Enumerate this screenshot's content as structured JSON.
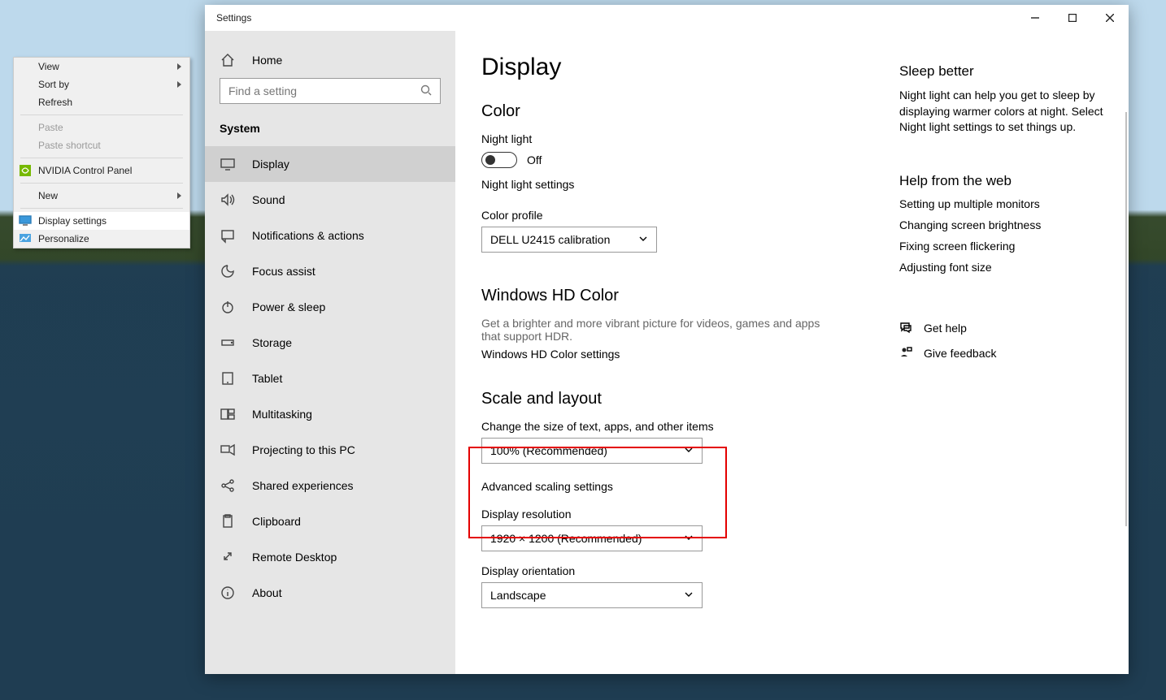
{
  "context_menu": {
    "items": [
      {
        "label": "View",
        "has_submenu": true
      },
      {
        "label": "Sort by",
        "has_submenu": true
      },
      {
        "label": "Refresh"
      }
    ],
    "items2": [
      {
        "label": "Paste",
        "disabled": true
      },
      {
        "label": "Paste shortcut",
        "disabled": true
      }
    ],
    "nvidia": "NVIDIA Control Panel",
    "new": "New",
    "display_settings": "Display settings",
    "personalize": "Personalize"
  },
  "window": {
    "title": "Settings"
  },
  "sidebar": {
    "home": "Home",
    "search_placeholder": "Find a setting",
    "group_header": "System",
    "items": [
      "Display",
      "Sound",
      "Notifications & actions",
      "Focus assist",
      "Power & sleep",
      "Storage",
      "Tablet",
      "Multitasking",
      "Projecting to this PC",
      "Shared experiences",
      "Clipboard",
      "Remote Desktop",
      "About"
    ]
  },
  "main": {
    "page_title": "Display",
    "color": {
      "heading": "Color",
      "night_light_label": "Night light",
      "night_light_state": "Off",
      "night_light_settings": "Night light settings",
      "color_profile_label": "Color profile",
      "color_profile_value": "DELL U2415 calibration"
    },
    "hdcolor": {
      "heading": "Windows HD Color",
      "desc": "Get a brighter and more vibrant picture for videos, games and apps that support HDR.",
      "link": "Windows HD Color settings"
    },
    "scale": {
      "heading": "Scale and layout",
      "change_size_label": "Change the size of text, apps, and other items",
      "size_value": "100% (Recommended)",
      "advanced": "Advanced scaling settings",
      "resolution_label": "Display resolution",
      "resolution_value": "1920 × 1200 (Recommended)",
      "orientation_label": "Display orientation",
      "orientation_value": "Landscape"
    }
  },
  "aside": {
    "sleep_heading": "Sleep better",
    "sleep_desc": "Night light can help you get to sleep by displaying warmer colors at night. Select Night light settings to set things up.",
    "help_heading": "Help from the web",
    "help_links": [
      "Setting up multiple monitors",
      "Changing screen brightness",
      "Fixing screen flickering",
      "Adjusting font size"
    ],
    "get_help": "Get help",
    "give_feedback": "Give feedback"
  }
}
